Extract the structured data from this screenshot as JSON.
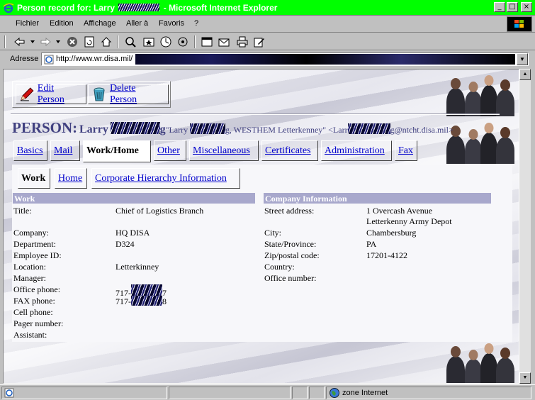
{
  "window": {
    "title_prefix": "Person record for: Larry",
    "title_suffix": "- Microsoft Internet Explorer",
    "minimize": "_",
    "maximize": "□",
    "close": "×"
  },
  "menu": [
    "Fichier",
    "Edition",
    "Affichage",
    "Aller à",
    "Favoris",
    "?"
  ],
  "address": {
    "label": "Adresse",
    "url": "http://www.wr.disa.mil/"
  },
  "actions": {
    "edit": "Edit Person",
    "delete": "Delete Person"
  },
  "person": {
    "label": "PERSON:",
    "first_name": "Larry",
    "name_tail": "g",
    "nickname_open": "\"Larry",
    "nickname_tail": "g, WESTHEM Letterkenney\" <Larr",
    "email_tail": "g@ntcht.disa.mil>"
  },
  "tabs": [
    "Basics",
    "Mail",
    "Work/Home",
    "Other",
    "Miscellaneous",
    "Certificates",
    "Administration",
    "Fax"
  ],
  "active_tab": "Work/Home",
  "subtabs": [
    "Work",
    "Home",
    "Corporate Hierarchy Information"
  ],
  "active_subtab": "Work",
  "work": {
    "header": "Work",
    "rows": [
      {
        "label": "Title:",
        "value": "Chief of Logistics Branch"
      },
      {
        "label": "Company:",
        "value": "HQ DISA"
      },
      {
        "label": "Department:",
        "value": "D324"
      },
      {
        "label": "Employee ID:",
        "value": ""
      },
      {
        "label": "Location:",
        "value": "Letterkinney"
      },
      {
        "label": "Manager:",
        "value": ""
      },
      {
        "label": "Office phone:",
        "value": "717-",
        "value_tail": "7"
      },
      {
        "label": "FAX phone:",
        "value": "717-",
        "value_tail": "8"
      },
      {
        "label": "Cell phone:",
        "value": ""
      },
      {
        "label": "Pager number:",
        "value": ""
      },
      {
        "label": "Assistant:",
        "value": ""
      }
    ]
  },
  "company": {
    "header": "Company Information",
    "rows": [
      {
        "label": "Street address:",
        "value": "1 Overcash Avenue",
        "value2": "Letterkenny Army Depot"
      },
      {
        "label": "City:",
        "value": "Chambersburg"
      },
      {
        "label": "State/Province:",
        "value": "PA"
      },
      {
        "label": "Zip/postal code:",
        "value": "17201-4122"
      },
      {
        "label": "Country:",
        "value": ""
      },
      {
        "label": "Office number:",
        "value": ""
      }
    ]
  },
  "status": {
    "zone": "zone Internet"
  },
  "colors": {
    "titlebar": "#00ff00",
    "section_header": "#a8a8cc",
    "link": "#0000cc",
    "person_heading": "#404080"
  }
}
